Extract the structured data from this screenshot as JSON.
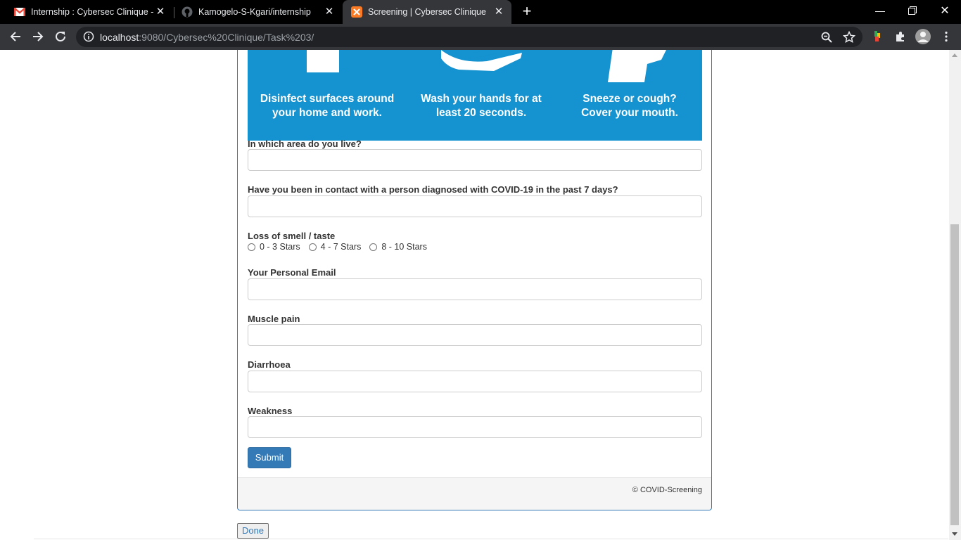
{
  "browser": {
    "tabs": [
      {
        "title": "Internship : Cybersec Clinique - k",
        "icon": "gmail-icon"
      },
      {
        "title": "Kamogelo-S-Kgari/internship",
        "icon": "github-icon"
      },
      {
        "title": "Screening | Cybersec Clinique",
        "icon": "xampp-icon"
      }
    ],
    "url_host": "localhost",
    "url_rest": ":9080/Cybersec%20Clinique/Task%203/"
  },
  "banner": {
    "captions": [
      "Disinfect surfaces around your home and work.",
      "Wash your hands for at least 20 seconds.",
      "Sneeze or cough? Cover your mouth."
    ],
    "color": "#1592d0"
  },
  "form": {
    "q_area": "In which area do you live?",
    "q_contact": "Have you been in contact with a person diagnosed with COVID-19 in the past 7 days?",
    "q_smell": "Loss of smell / taste",
    "smell_options": [
      "0 - 3 Stars",
      "4 - 7 Stars",
      "8 - 10 Stars"
    ],
    "q_email": "Your Personal Email",
    "q_muscle": "Muscle pain",
    "q_diarrhoea": "Diarrhoea",
    "q_weakness": "Weakness",
    "submit_label": "Submit"
  },
  "footer": {
    "copyright": "© COVID-Screening"
  },
  "done_label": "Done"
}
